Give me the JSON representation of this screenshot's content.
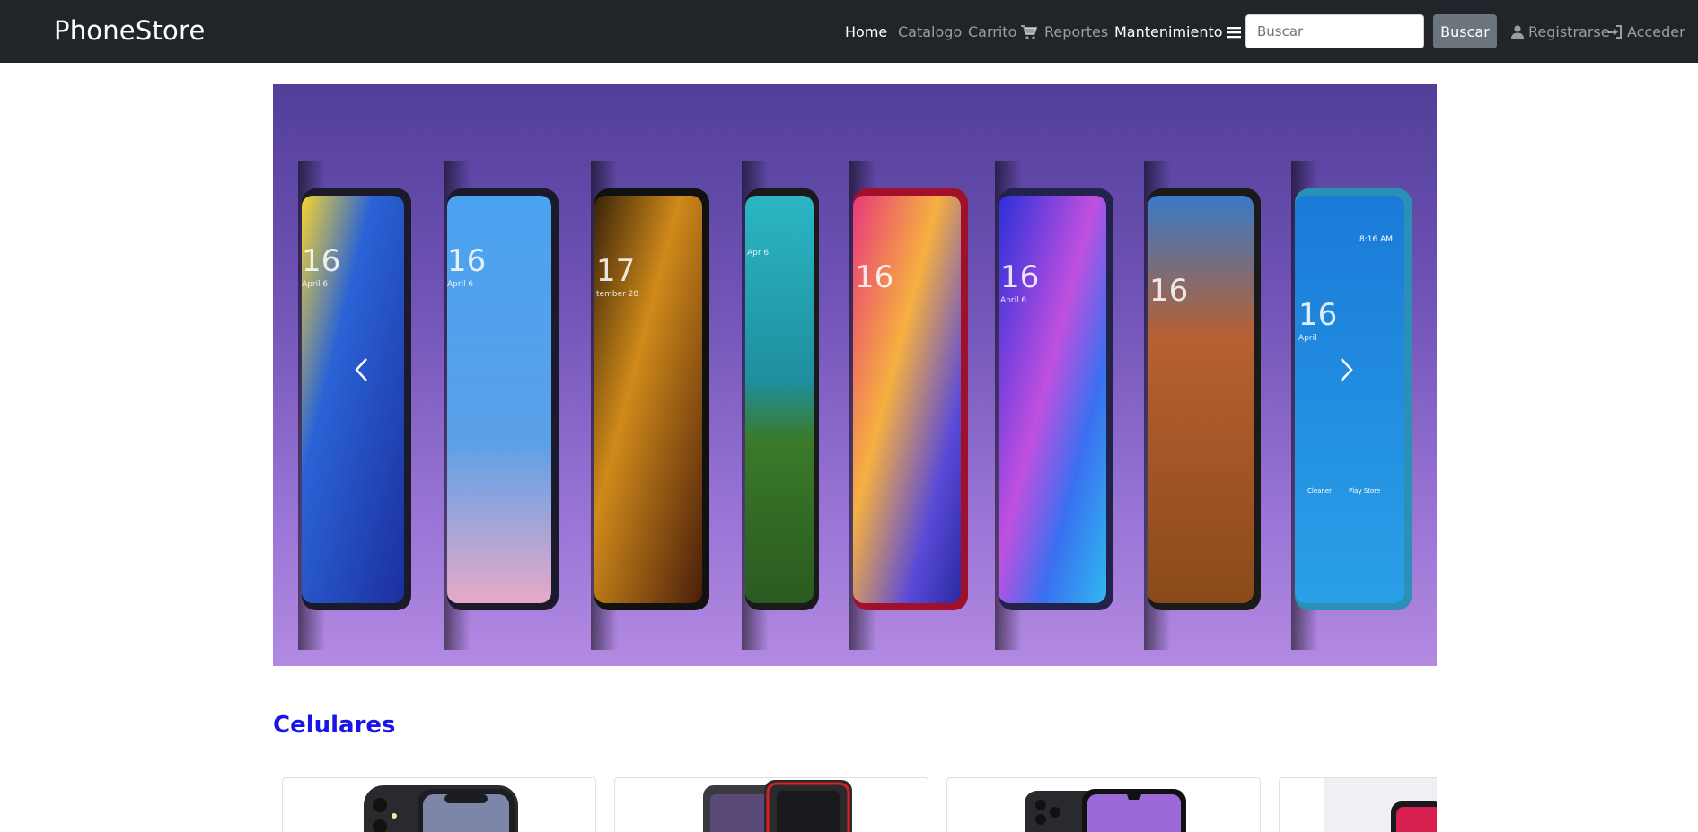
{
  "navbar": {
    "brand": "PhoneStore",
    "links": {
      "home": "Home",
      "catalogo": "Catalogo",
      "carrito": "Carrito",
      "reportes": "Reportes",
      "mantenimiento": "Mantenimiento",
      "registrarse": "Registrarse",
      "acceder": "Acceder"
    },
    "search": {
      "placeholder": "Buscar",
      "value": "",
      "button_label": "Buscar"
    },
    "icons": {
      "carrito": "shopping-cart-icon",
      "mantenimiento": "bars-icon",
      "registrarse": "user-icon",
      "acceder": "sign-in-icon"
    }
  },
  "carousel": {
    "slide_image": "row of smartphones on purple background",
    "clock_labels": [
      "16",
      "16",
      "17",
      "",
      "16",
      "16",
      "16",
      "16"
    ],
    "date_labels": [
      "April 6",
      "April 6",
      "tember 28",
      "Apr 6",
      "",
      "April 6",
      "",
      "April"
    ],
    "status_time": "8:16 AM",
    "app_labels": [
      "Cleaner",
      "Play Store"
    ],
    "prev_icon": "chevron-left-icon",
    "next_icon": "chevron-right-icon"
  },
  "section": {
    "title": "Celulares"
  },
  "products": [
    {
      "name": "product-card-1"
    },
    {
      "name": "product-card-2"
    },
    {
      "name": "product-card-3"
    },
    {
      "name": "product-card-4"
    }
  ],
  "colors": {
    "navbar_bg": "#212529",
    "section_title": "#1a14e8",
    "carousel_top": "#523f98",
    "carousel_bottom": "#b38ae2",
    "button_secondary": "#6c757d"
  }
}
